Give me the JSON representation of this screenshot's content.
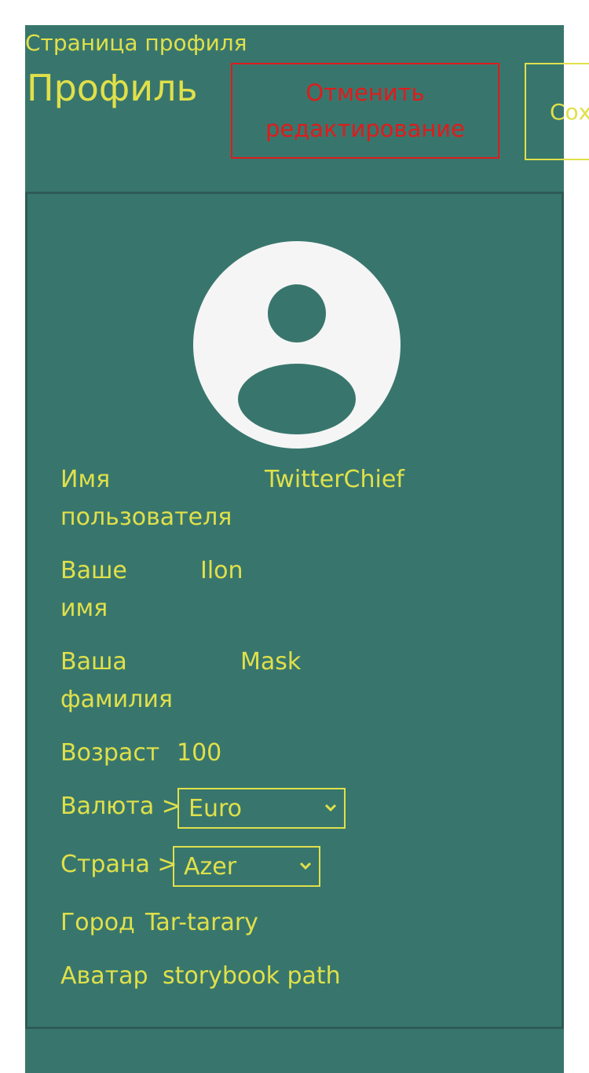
{
  "header": {
    "breadcrumb": "Страница профиля",
    "title": "Профиль",
    "cancel_label": "Отменить редактирование",
    "save_label": "Сохранить"
  },
  "profile": {
    "avatar_icon": "user-avatar-icon",
    "fields": {
      "username": {
        "label": "Имя пользователя",
        "value": "TwitterChief"
      },
      "firstname": {
        "label": "Ваше имя",
        "value": "Ilon"
      },
      "lastname": {
        "label": "Ваша фамилия",
        "value": "Mask"
      },
      "age": {
        "label": "Возраст",
        "value": "100"
      },
      "currency": {
        "label": "Валюта >",
        "selected": "Euro"
      },
      "country": {
        "label": "Страна >",
        "selected": "Azer"
      },
      "city": {
        "label": "Город",
        "value": "Tar-tarary"
      },
      "avatar": {
        "label": "Аватар",
        "value": "storybook path"
      }
    }
  },
  "colors": {
    "background": "#38766d",
    "accent": "#e0e04a",
    "danger": "#e01b1b",
    "panel_border": "#2e5a54"
  }
}
